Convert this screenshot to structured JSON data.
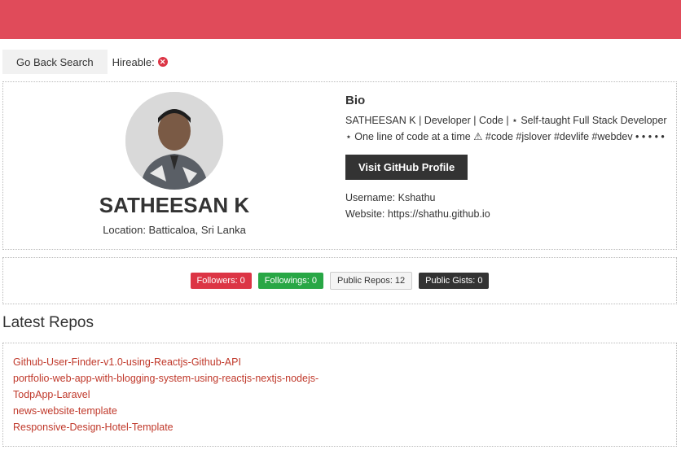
{
  "toolbar": {
    "back_label": "Go Back Search",
    "hireable_label": "Hireable:",
    "hireable_icon": "x-circle-icon"
  },
  "profile": {
    "name": "SATHEESAN K",
    "location": "Location: Batticaloa, Sri Lanka",
    "bio_title": "Bio",
    "bio_text": "SATHEESAN K | Developer | Code | ⋆ Self-taught Full Stack Developer ⋆ One line of code at a time ⚠ #code #jslover #devlife #webdev • • • • •",
    "visit_label": "Visit GitHub Profile",
    "username": "Username: Kshathu",
    "website": "Website: https://shathu.github.io"
  },
  "badges": {
    "followers": "Followers: 0",
    "followings": "Followings: 0",
    "repos": "Public Repos: 12",
    "gists": "Public Gists: 0"
  },
  "latest": {
    "title": "Latest Repos",
    "repos": [
      "Github-User-Finder-v1.0-using-Reactjs-Github-API",
      "portfolio-web-app-with-blogging-system-using-reactjs-nextjs-nodejs-",
      "TodpApp-Laravel",
      "news-website-template",
      "Responsive-Design-Hotel-Template"
    ]
  },
  "colors": {
    "topbar": "#e04b5a",
    "link": "#c0392b",
    "danger": "#dc3545",
    "success": "#28a745",
    "dark": "#333333"
  }
}
